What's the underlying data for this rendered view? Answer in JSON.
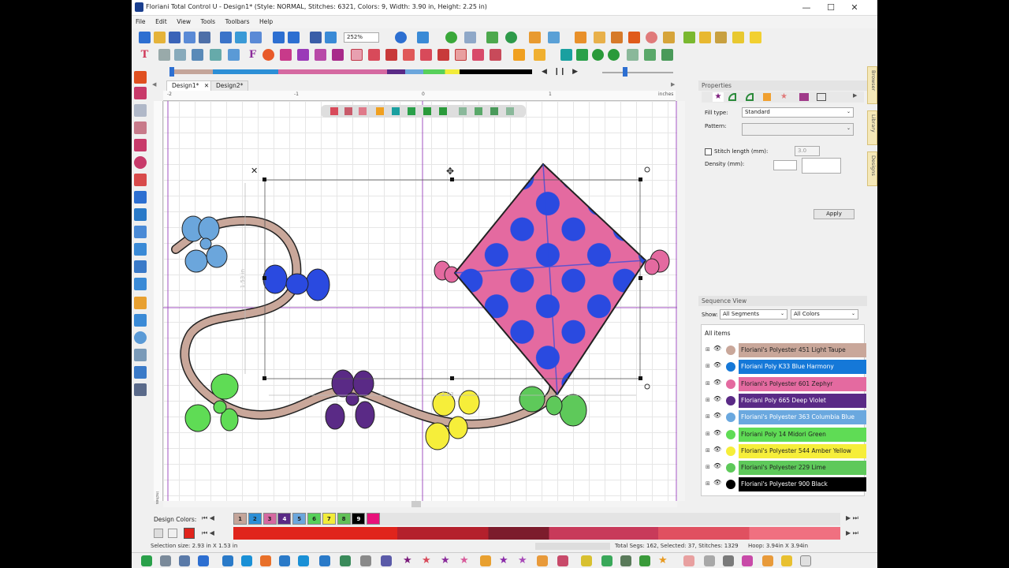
{
  "window": {
    "title": "Floriani Total Control U - Design1* (Style: NORMAL, Stitches: 6321, Colors: 9, Width: 3.90 in, Height: 2.25 in)",
    "minimize": "—",
    "maximize": "☐",
    "close": "✕"
  },
  "menu": [
    "File",
    "Edit",
    "View",
    "Tools",
    "Toolbars",
    "Help"
  ],
  "toolbar": {
    "zoom": "252%"
  },
  "tabs": [
    {
      "label": "Design1*",
      "close": "✕"
    },
    {
      "label": "Design2*"
    }
  ],
  "ruler": {
    "ticks": [
      "-2",
      "-1",
      "0",
      "1"
    ],
    "unit": "inches",
    "side_unit": "inches"
  },
  "canvas": {
    "dim_height": "1.53 in",
    "dim_width": "2.93"
  },
  "properties": {
    "title": "Properties",
    "fill_type_label": "Fill type:",
    "fill_type_value": "Standard",
    "pattern_label": "Pattern:",
    "stitch_length_label": "Stitch length (mm):",
    "stitch_length_value": "3.0",
    "density_label": "Density (mm):",
    "apply": "Apply"
  },
  "sequence": {
    "title": "Sequence View",
    "show_label": "Show:",
    "segments_value": "All Segments",
    "colors_value": "All Colors",
    "all_items": "All items",
    "rows": [
      {
        "label": "Floriani's Polyester 451 Light Taupe",
        "color": "#c9a79a",
        "text": "#222"
      },
      {
        "label": "Floriani Poly K33 Blue Harmony",
        "color": "#1578d8",
        "text": "#fff"
      },
      {
        "label": "Floriani's Polyester 601 Zephyr",
        "color": "#e46aa0",
        "text": "#222"
      },
      {
        "label": "Floriani Poly 665 Deep Violet",
        "color": "#5a2a86",
        "text": "#fff"
      },
      {
        "label": "Floriani's Polyester 363 Columbia Blue",
        "color": "#6aa8df",
        "text": "#fff"
      },
      {
        "label": "Floriani Poly 14 Midori Green",
        "color": "#5fdc55",
        "text": "#222"
      },
      {
        "label": "Floriani's Polyester 544 Amber Yellow",
        "color": "#f6ee3a",
        "text": "#222"
      },
      {
        "label": "Floriani's Polyester 229 Lime",
        "color": "#5ec95a",
        "text": "#222"
      },
      {
        "label": "Floriani's Polyester 900 Black",
        "color": "#000000",
        "text": "#fff"
      }
    ]
  },
  "side_tabs": [
    "Browser",
    "Library",
    "Designs"
  ],
  "design_colors": {
    "label": "Design Colors:",
    "swatches": [
      {
        "n": "1",
        "color": "#c4a59a"
      },
      {
        "n": "2",
        "color": "#2c8fd6"
      },
      {
        "n": "3",
        "color": "#d569a1"
      },
      {
        "n": "4",
        "color": "#5a2a86"
      },
      {
        "n": "5",
        "color": "#6ba6dc"
      },
      {
        "n": "6",
        "color": "#57d05a"
      },
      {
        "n": "7",
        "color": "#f2ec3a"
      },
      {
        "n": "8",
        "color": "#62c157"
      },
      {
        "n": "9",
        "color": "#000000"
      },
      {
        "n": "",
        "color": "#e8127a"
      }
    ]
  },
  "status": {
    "selection_size": "Selection size: 2.93 in X 1.53 in",
    "segments": "Total Segs: 162, Selected: 37, Stitches: 1329",
    "hoop": "Hoop: 3.94in X 3.94in"
  }
}
